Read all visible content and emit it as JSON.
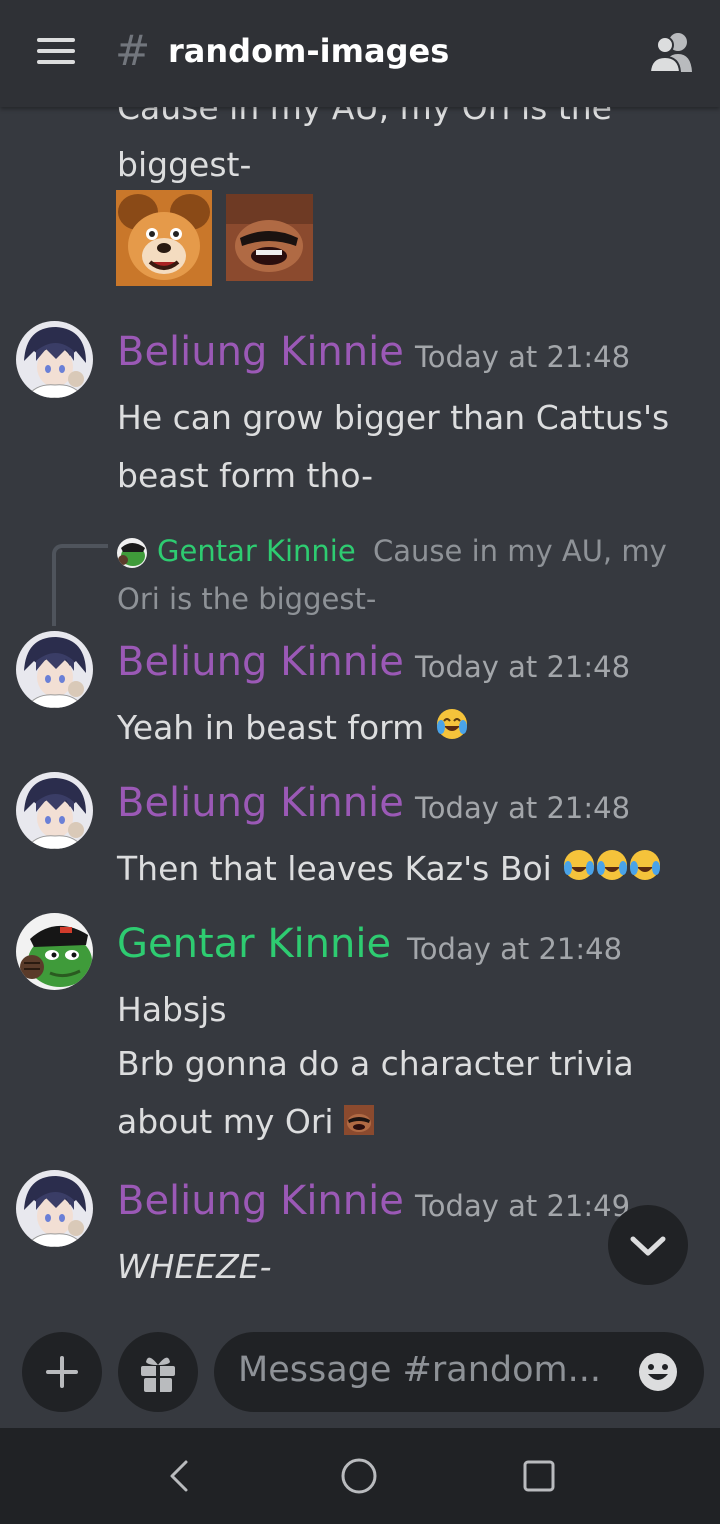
{
  "header": {
    "hash": "#",
    "channel_name": "random-images"
  },
  "messages": {
    "m0": {
      "line1": "Cause in my AU, my Ori is the",
      "line2": "biggest-"
    },
    "m1": {
      "author": "Beliung Kinnie",
      "time": "Today at 21:48",
      "line1": "He can grow bigger than Cattus's",
      "line2": "beast form tho-"
    },
    "m2": {
      "reply": {
        "author": "Gentar Kinnie",
        "text1": "Cause in my AU, my",
        "text2": "Ori is the biggest-"
      },
      "author": "Beliung Kinnie",
      "time": "Today at 21:48",
      "line1": "Yeah in beast form"
    },
    "m3": {
      "author": "Beliung Kinnie",
      "time": "Today at 21:48",
      "line1": "Then that leaves Kaz's Boi"
    },
    "m4": {
      "author": "Gentar Kinnie",
      "time": "Today at 21:48",
      "line1": "Habsjs",
      "line2": "Brb gonna do a character trivia",
      "line3": "about my Ori"
    },
    "m5": {
      "author": "Beliung Kinnie",
      "time": "Today at 21:49",
      "line1": "WHEEZE-"
    }
  },
  "composer": {
    "placeholder": "Message #random..."
  },
  "colors": {
    "background": "#36393f",
    "header": "#2f3136",
    "purple_role": "#9b59b6",
    "green_role": "#2ecc71"
  }
}
